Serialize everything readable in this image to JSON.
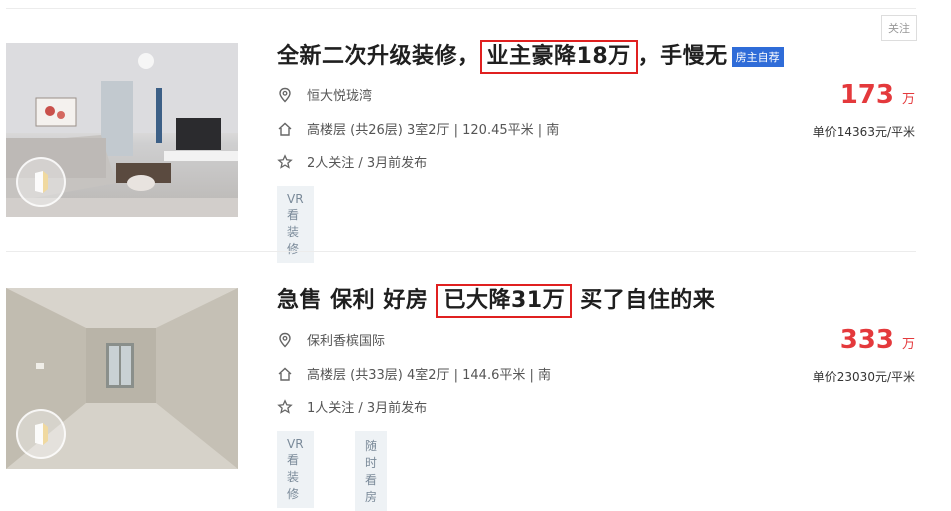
{
  "follow_label": "关注",
  "listings": [
    {
      "title_pre": "全新二次升级装修，",
      "title_hl": "业主豪降18万",
      "title_post": "，手慢无",
      "owner_tag": "房主自荐",
      "community": "恒大悦珑湾",
      "details": "高楼层 (共26层) 3室2厅 | 120.45平米 | 南",
      "followers": "2人关注 / 3月前发布",
      "tags": [
        "VR看装修"
      ],
      "price": "173",
      "price_unit": "万",
      "unit_price": "单价14363元/平米"
    },
    {
      "title_pre": "急售 保利 好房 ",
      "title_hl": "已大降31万",
      "title_post": " 买了自住的来",
      "owner_tag": "",
      "community": "保利香槟国际",
      "details": "高楼层 (共33层) 4室2厅 | 144.6平米 | 南",
      "followers": "1人关注 / 3月前发布",
      "tags": [
        "VR看装修",
        "随时看房"
      ],
      "price": "333",
      "price_unit": "万",
      "unit_price": "单价23030元/平米"
    }
  ],
  "colors": {
    "price": "#e4393c",
    "highlight_border": "#e02020",
    "owner_tag_bg": "#2f6cd8",
    "tag_bg": "#eef2f5"
  },
  "icons": {
    "location": "map-pin-icon",
    "house": "house-icon",
    "star": "star-icon",
    "vr": "vr-icon"
  }
}
